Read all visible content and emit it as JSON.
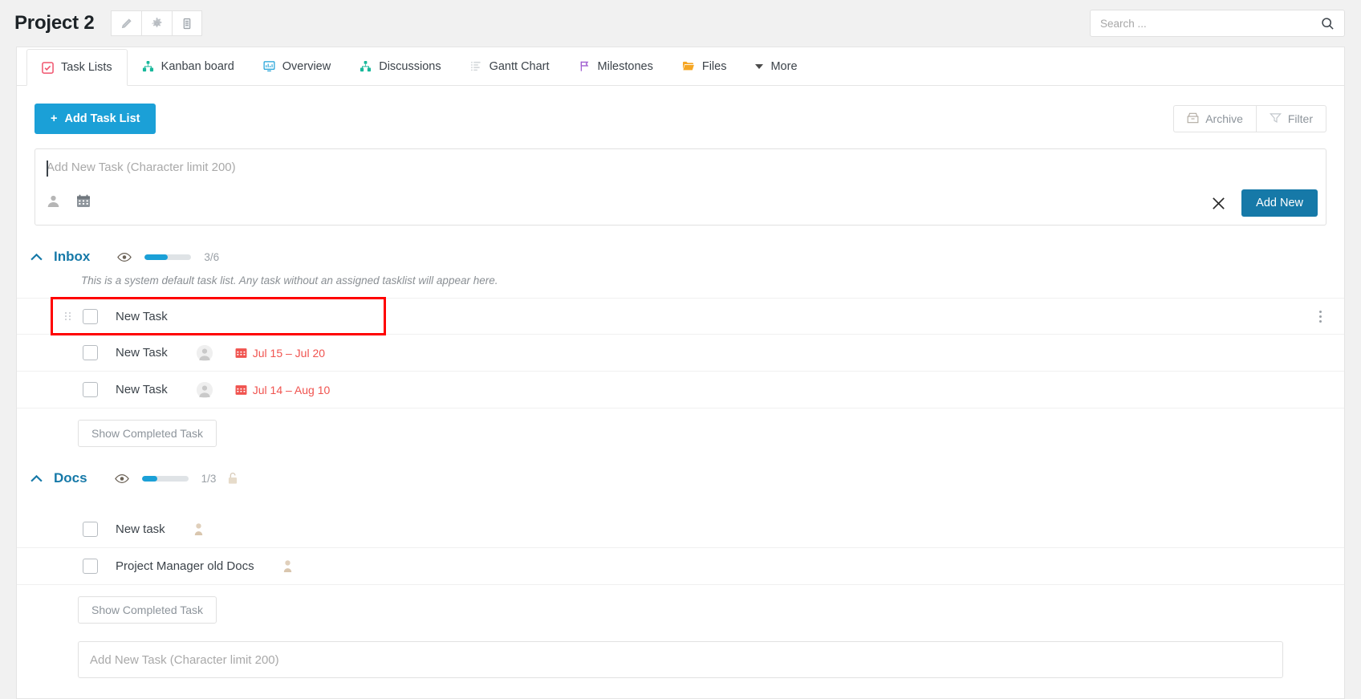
{
  "header": {
    "project_title": "Project 2",
    "icon_buttons": [
      {
        "name": "edit-pencil-icon",
        "label": "Edit"
      },
      {
        "name": "gear-icon",
        "label": "Settings"
      },
      {
        "name": "document-icon",
        "label": "Notes"
      }
    ],
    "search": {
      "placeholder": "Search ...",
      "value": "",
      "icon": "search-icon"
    }
  },
  "tabs": [
    {
      "label": "Task Lists",
      "icon": "task-lists-icon",
      "active": true,
      "color": "#f0536d"
    },
    {
      "label": "Kanban board",
      "icon": "kanban-icon",
      "active": false,
      "color": "#18b89b"
    },
    {
      "label": "Overview",
      "icon": "overview-icon",
      "active": false,
      "color": "#1ba0d7"
    },
    {
      "label": "Discussions",
      "icon": "discussions-icon",
      "active": false,
      "color": "#18b89b"
    },
    {
      "label": "Gantt Chart",
      "icon": "gantt-icon",
      "active": false,
      "color": "#d5d9dc"
    },
    {
      "label": "Milestones",
      "icon": "milestones-icon",
      "active": false,
      "color": "#a05fd0"
    },
    {
      "label": "Files",
      "icon": "folder-icon",
      "active": false,
      "color": "#f5a623"
    },
    {
      "label": "More",
      "icon": "chevron-down-icon",
      "active": false,
      "color": "#4b4b4b"
    }
  ],
  "toolbar": {
    "add_task_list_label": "Add Task List",
    "add_task_list_plus": "+",
    "archive_label": "Archive",
    "archive_icon": "archive-box-icon",
    "filter_label": "Filter",
    "filter_icon": "funnel-icon"
  },
  "composer": {
    "placeholder": "Add New Task (Character limit 200)",
    "value": "",
    "assignee_icon": "person-icon",
    "date_icon": "calendar-icon",
    "close_icon": "close-x-icon",
    "add_new_label": "Add New"
  },
  "sections": [
    {
      "title": "Inbox",
      "collapse_icon": "chevron-up-icon",
      "visibility_icon": "eye-icon",
      "progress_percent": 50,
      "progress_label": "3/6",
      "has_lock": false,
      "description": "This is a system default task list. Any task without an assigned tasklist will appear here.",
      "show_completed_label": "Show Completed Task",
      "tasks": [
        {
          "title": "New Task",
          "checked": false,
          "has_avatar": false,
          "date": "",
          "highlighted": true,
          "has_drag": true,
          "has_kebab": true
        },
        {
          "title": "New Task",
          "checked": false,
          "has_avatar": true,
          "date": "Jul 15 – Jul 20",
          "highlighted": false,
          "has_drag": false,
          "has_kebab": false
        },
        {
          "title": "New Task",
          "checked": false,
          "has_avatar": true,
          "date": "Jul 14 – Aug 10",
          "highlighted": false,
          "has_drag": false,
          "has_kebab": false
        }
      ]
    },
    {
      "title": "Docs",
      "collapse_icon": "chevron-up-icon",
      "visibility_icon": "eye-icon",
      "progress_percent": 33,
      "progress_label": "1/3",
      "has_lock": true,
      "lock_icon": "unlock-icon",
      "description": "",
      "show_completed_label": "Show Completed Task",
      "tasks": [
        {
          "title": "New task",
          "checked": false,
          "has_avatar": false,
          "has_person": true,
          "date": "",
          "highlighted": false,
          "has_drag": false,
          "has_kebab": false
        },
        {
          "title": "Project Manager old Docs",
          "checked": false,
          "has_avatar": false,
          "has_person": true,
          "date": "",
          "highlighted": false,
          "has_drag": false,
          "has_kebab": false
        }
      ]
    }
  ],
  "bottom_composer": {
    "placeholder": "Add New Task (Character limit 200)",
    "value": ""
  },
  "colors": {
    "accent": "#1ba0d7",
    "accent_dark": "#1679a8",
    "danger": "#f0534f",
    "highlight": "#ff0000"
  }
}
